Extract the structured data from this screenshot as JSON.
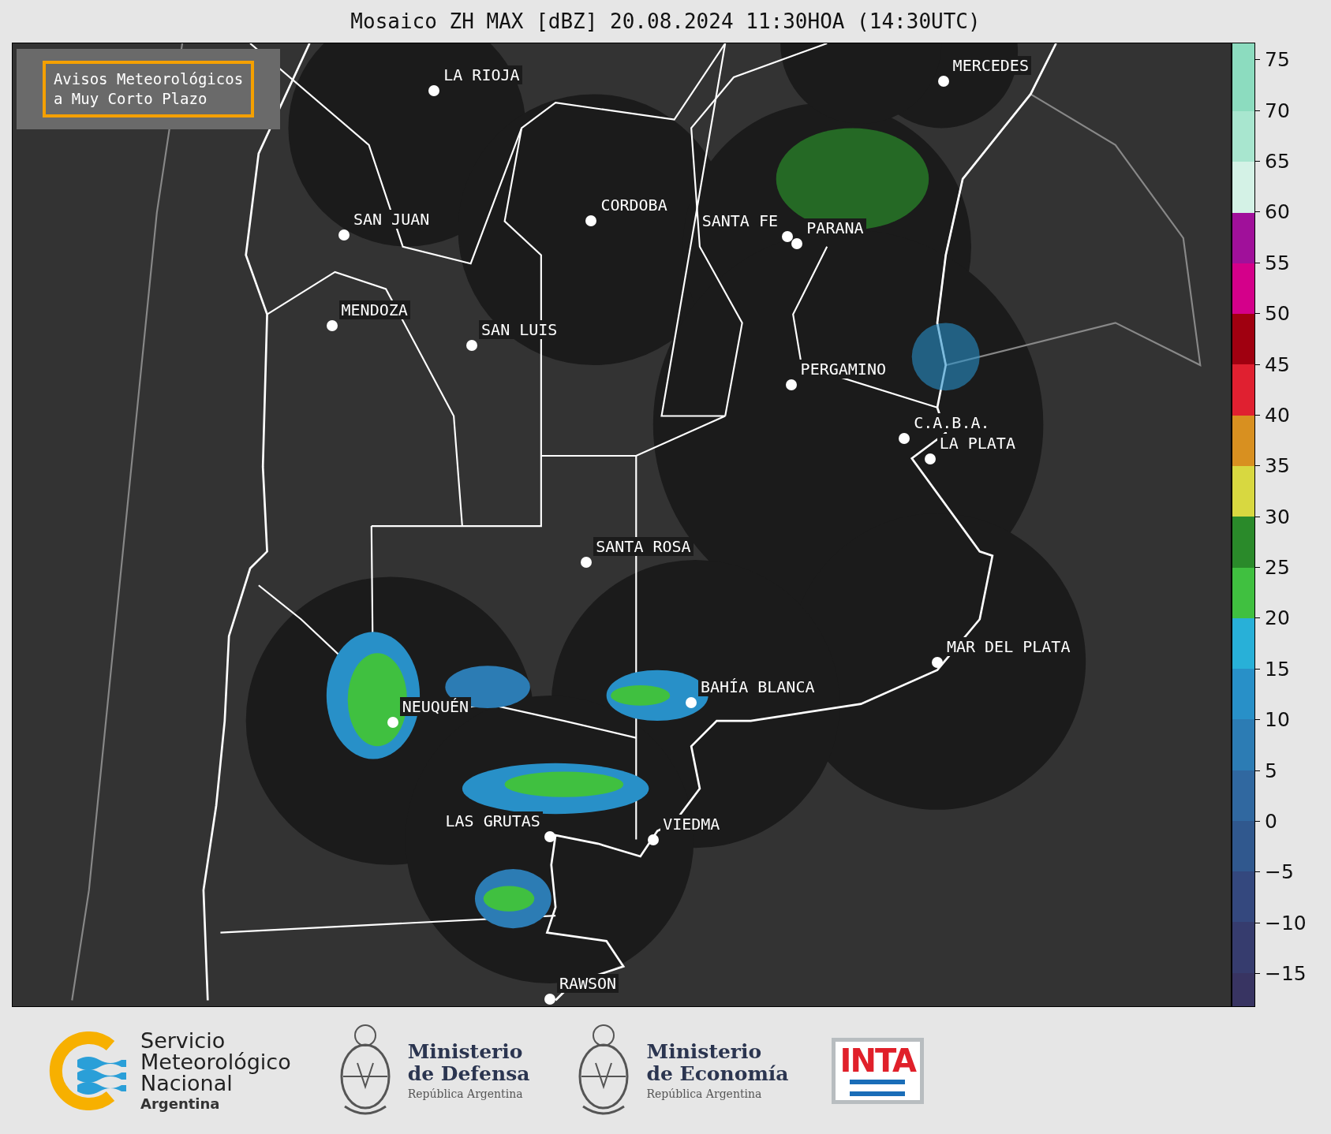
{
  "title": "Mosaico ZH MAX [dBZ] 20.08.2024 11:30HOA (14:30UTC)",
  "notice": {
    "lines": [
      "Avisos Meteorológicos",
      "a Muy Corto Plazo"
    ]
  },
  "map": {
    "cities": [
      {
        "name": "LA RIOJA"
      },
      {
        "name": "MERCEDES"
      },
      {
        "name": "SAN JUAN"
      },
      {
        "name": "CORDOBA"
      },
      {
        "name": "SANTA FE"
      },
      {
        "name": "PARANA"
      },
      {
        "name": "MENDOZA"
      },
      {
        "name": "SAN LUIS"
      },
      {
        "name": "PERGAMINO"
      },
      {
        "name": "C.A.B.A."
      },
      {
        "name": "LA PLATA"
      },
      {
        "name": "SANTA ROSA"
      },
      {
        "name": "MAR DEL PLATA"
      },
      {
        "name": "BAHÍA BLANCA"
      },
      {
        "name": "NEUQUÉN"
      },
      {
        "name": "LAS GRUTAS"
      },
      {
        "name": "VIEDMA"
      },
      {
        "name": "RAWSON"
      }
    ]
  },
  "colorbar": {
    "ticks": [
      "75",
      "70",
      "65",
      "60",
      "55",
      "50",
      "45",
      "40",
      "35",
      "30",
      "25",
      "20",
      "15",
      "10",
      "5",
      "0",
      "−5",
      "−10",
      "−15"
    ],
    "bands": [
      {
        "color": "#8cdcbf"
      },
      {
        "color": "#a8e6cf"
      },
      {
        "color": "#d4f2e6"
      },
      {
        "color": "#a0109a"
      },
      {
        "color": "#d4008a"
      },
      {
        "color": "#a00010"
      },
      {
        "color": "#e02030"
      },
      {
        "color": "#d89020"
      },
      {
        "color": "#d8d840"
      },
      {
        "color": "#2a8a2a"
      },
      {
        "color": "#40c040"
      },
      {
        "color": "#28b0d8"
      },
      {
        "color": "#2890c8"
      },
      {
        "color": "#2c7cb4"
      },
      {
        "color": "#3068a0"
      },
      {
        "color": "#30588e"
      },
      {
        "color": "#34487e"
      },
      {
        "color": "#363c6e"
      },
      {
        "color": "#383462"
      }
    ]
  },
  "footer": {
    "logos": [
      {
        "kind": "smn",
        "lines": [
          "Servicio",
          "Meteorológico",
          "Nacional"
        ],
        "subtitle": "Argentina"
      },
      {
        "kind": "ministry",
        "lines": [
          "Ministerio",
          "de Defensa"
        ],
        "subtitle": "República Argentina"
      },
      {
        "kind": "ministry",
        "lines": [
          "Ministerio",
          "de Economía"
        ],
        "subtitle": "República Argentina"
      },
      {
        "kind": "inta",
        "lines": [
          "INTA"
        ]
      }
    ]
  }
}
